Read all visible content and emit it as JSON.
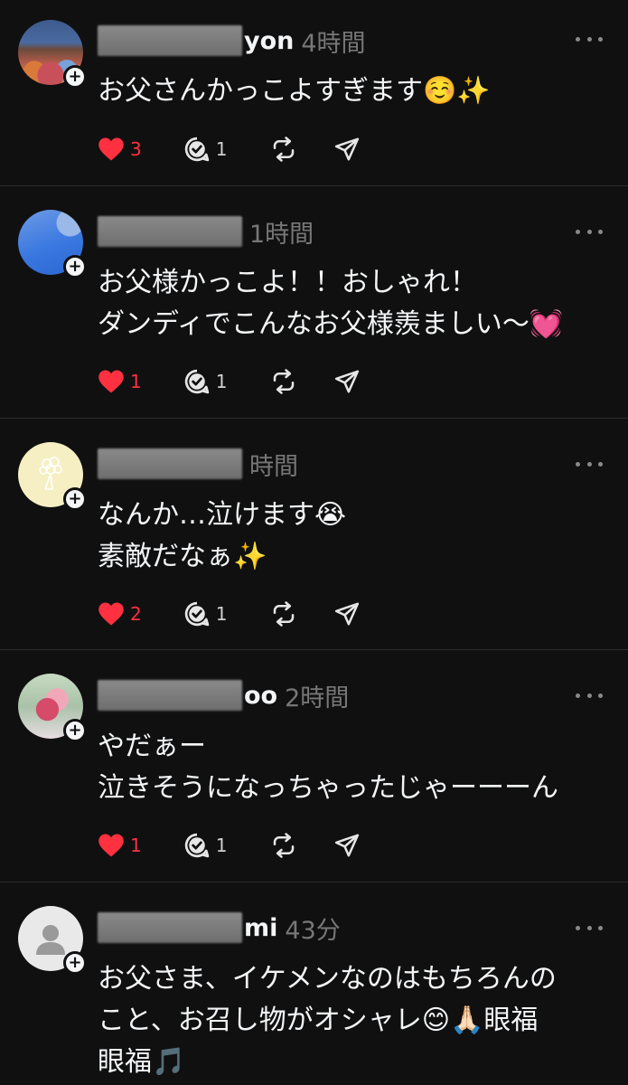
{
  "posts": [
    {
      "handle_visible": "yon",
      "time": "4時間",
      "text": "お父さんかっこよすぎます☺️✨",
      "likes": "3",
      "replies": "1"
    },
    {
      "handle_visible": "",
      "time": "1時間",
      "text": "お父様かっこよ！！おしゃれ！\nダンディでこんなお父様羨ましい〜💓",
      "likes": "1",
      "replies": "1"
    },
    {
      "handle_visible": "",
      "time": "時間",
      "text": "なんか…泣けます😭\n素敵だなぁ✨",
      "likes": "2",
      "replies": "1"
    },
    {
      "handle_visible": "oo",
      "time": "2時間",
      "text": "やだぁー\n泣きそうになっちゃったじゃーーーん",
      "likes": "1",
      "replies": "1"
    },
    {
      "handle_visible": "mi",
      "time": "43分",
      "text": "お父さま、イケメンなのはもちろんの\nこと、お召し物がオシャレ😊🙏🏻眼福\n眼福🎵",
      "likes": "",
      "replies": ""
    }
  ],
  "colors": {
    "background": "#101010",
    "text": "#f3f5f7",
    "muted": "#777777",
    "like_red": "#ff3040",
    "divider": "#2b2b2b"
  },
  "icons": {
    "like": "heart-icon",
    "reply": "reply-bubble-icon",
    "repost": "repost-icon",
    "share": "send-icon",
    "more": "more-dots-icon",
    "follow": "plus-icon"
  }
}
